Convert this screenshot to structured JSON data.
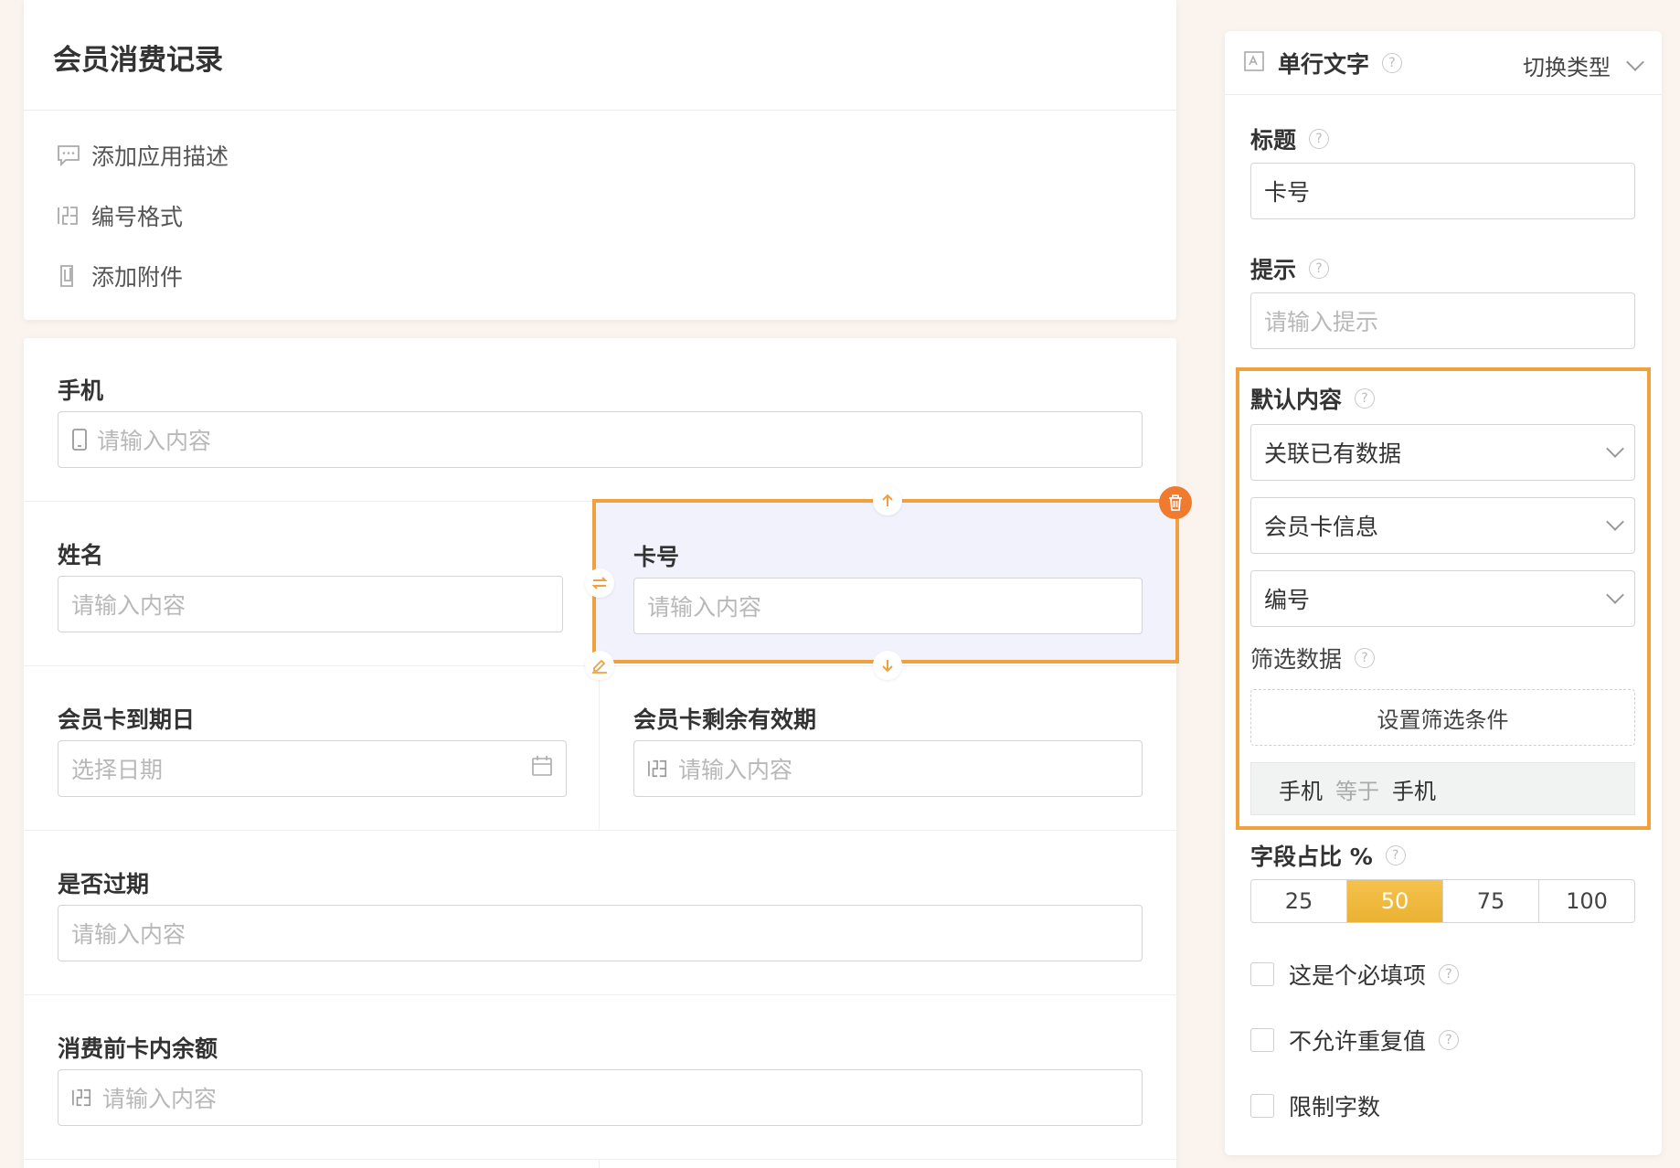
{
  "app": {
    "title": "会员消费记录"
  },
  "header_links": [
    {
      "label": "添加应用描述",
      "icon": "comment-icon"
    },
    {
      "label": "编号格式",
      "icon": "number-icon"
    },
    {
      "label": "添加附件",
      "icon": "attachment-icon"
    }
  ],
  "form": {
    "phone": {
      "label": "手机",
      "placeholder": "请输入内容"
    },
    "name": {
      "label": "姓名",
      "placeholder": "请输入内容"
    },
    "card_no": {
      "label": "卡号",
      "placeholder": "请输入内容"
    },
    "expire_date": {
      "label": "会员卡到期日",
      "placeholder": "选择日期"
    },
    "remaining": {
      "label": "会员卡剩余有效期",
      "placeholder": "请输入内容"
    },
    "expired": {
      "label": "是否过期",
      "placeholder": "请输入内容"
    },
    "balance": {
      "label": "消费前卡内余额",
      "placeholder": "请输入内容"
    }
  },
  "panel": {
    "type_label": "单行文字",
    "switch_type": "切换类型",
    "title_label": "标题",
    "title_value": "卡号",
    "hint_label": "提示",
    "hint_placeholder": "请输入提示",
    "default_label": "默认内容",
    "default_source": "关联已有数据",
    "default_table": "会员卡信息",
    "default_field": "编号",
    "filter_label": "筛选数据",
    "filter_button": "设置筛选条件",
    "filter_condition": {
      "left": "手机",
      "op": "等于",
      "right": "手机"
    },
    "ratio_label": "字段占比 %",
    "ratio_options": [
      "25",
      "50",
      "75",
      "100"
    ],
    "ratio_selected": "50",
    "required_label": "这是个必填项",
    "unique_label": "不允许重复值",
    "limit_label": "限制字数"
  },
  "colors": {
    "accent": "#f0a13f",
    "delete": "#f07b2f",
    "selected_bg": "#f2f2fc",
    "ratio_active": "#eab234"
  }
}
